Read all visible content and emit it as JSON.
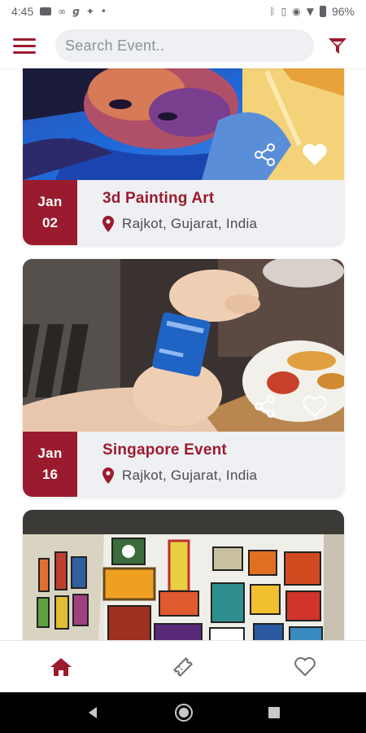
{
  "status_bar": {
    "time": "4:45",
    "battery": "96%"
  },
  "search": {
    "placeholder": "Search Event.."
  },
  "events": [
    {
      "month": "Jan",
      "day": "02",
      "title": "3d Painting Art",
      "location": "Rajkot, Gujarat, India",
      "liked": true
    },
    {
      "month": "Jan",
      "day": "16",
      "title": "Singapore Event",
      "location": "Rajkot, Gujarat, India",
      "liked": false
    }
  ],
  "bottom_nav": {
    "items": [
      "home-icon",
      "ticket-icon",
      "heart-icon"
    ],
    "active": "home-icon"
  },
  "colors": {
    "accent": "#9b1b2e",
    "card_bg": "#eef0f3",
    "icon_grey": "#6b6e73"
  }
}
